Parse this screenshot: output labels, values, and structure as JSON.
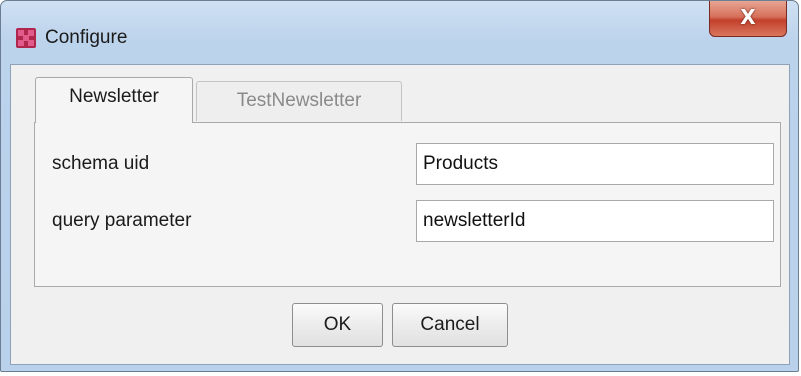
{
  "window": {
    "title": "Configure",
    "close_glyph": "X",
    "icon": "app-logo-icon"
  },
  "tabs": [
    {
      "label": "Newsletter",
      "active": true
    },
    {
      "label": "TestNewsletter",
      "active": false
    }
  ],
  "fields": {
    "schema_uid": {
      "label": "schema uid",
      "value": "Products"
    },
    "query_parameter": {
      "label": "query parameter",
      "value": "newsletterId"
    }
  },
  "buttons": {
    "ok": "OK",
    "cancel": "Cancel"
  },
  "colors": {
    "title_bar": "#bcd3ec",
    "close_button": "#c2402b",
    "app_icon": "#b0264d"
  }
}
